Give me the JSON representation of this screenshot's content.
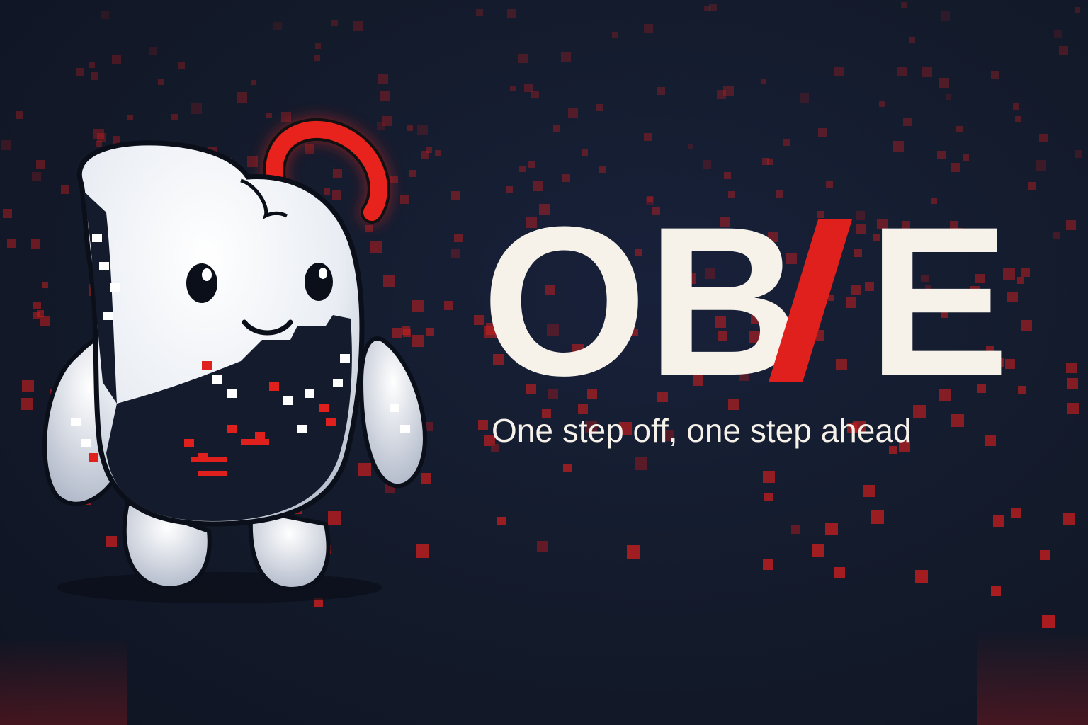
{
  "brand": {
    "logo_letters": "OB",
    "logo_letter_e": "E",
    "tagline": "One step off, one step ahead"
  },
  "colors": {
    "background": "#131a2a",
    "accent_red": "#e0201c",
    "logo_text": "#f6f2ea"
  },
  "mascot": {
    "icon": "ghost-robot-mascot-icon"
  }
}
